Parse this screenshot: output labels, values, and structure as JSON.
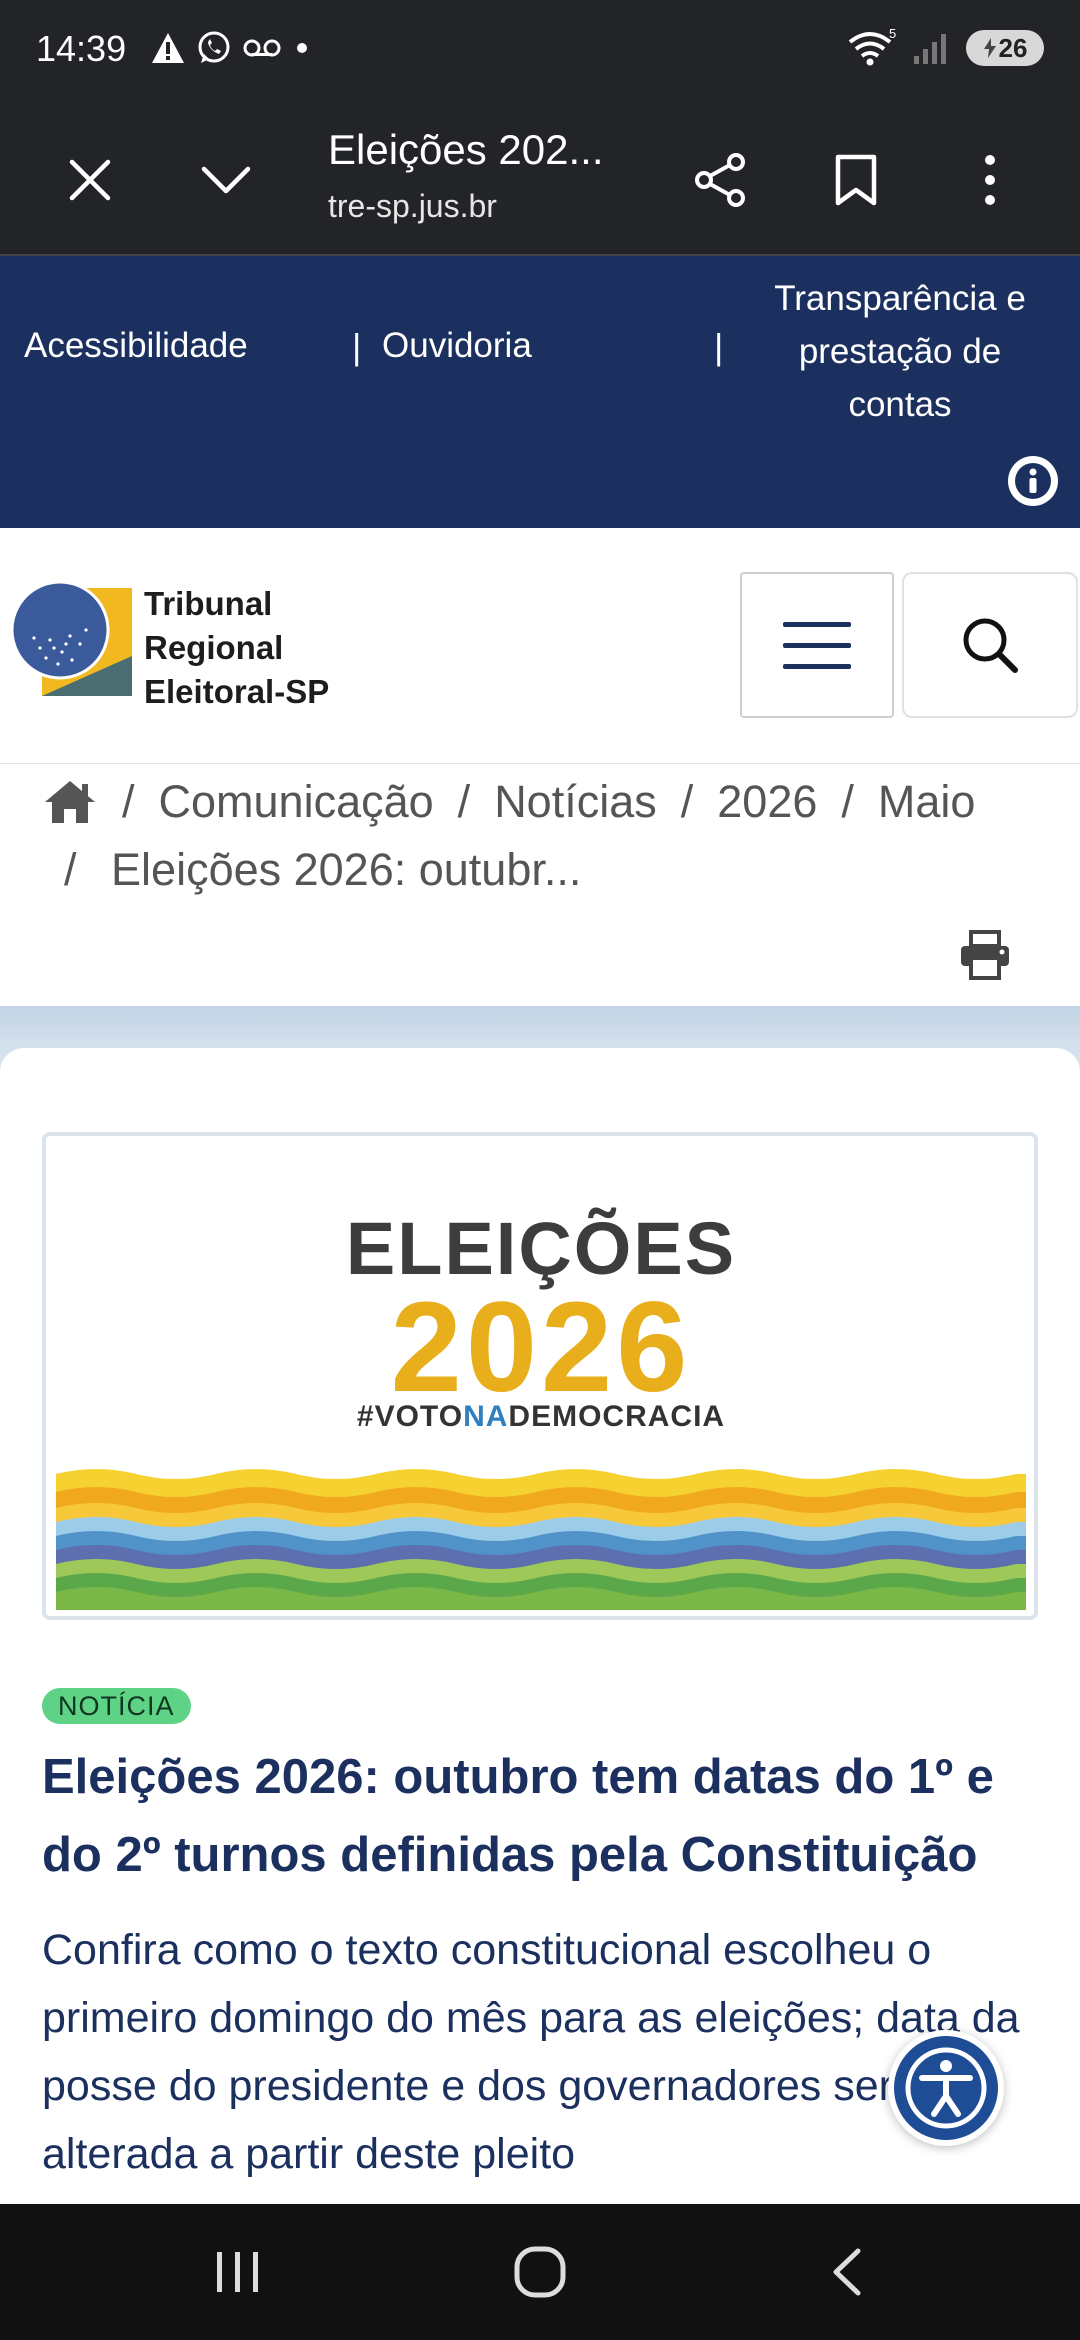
{
  "status_bar": {
    "time": "14:39",
    "left_icons": [
      "warning-icon",
      "whatsapp-icon",
      "voicemail-icon",
      "dot-icon"
    ],
    "wifi_badge": "5",
    "battery_level": "26"
  },
  "browser": {
    "page_title": "Eleições 202...",
    "url": "tre-sp.jus.br",
    "icons": [
      "close-icon",
      "chevron-down-icon",
      "share-icon",
      "bookmark-icon",
      "more-vertical-icon"
    ]
  },
  "top_nav": {
    "accessibility": "Acessibilidade",
    "ombudsman": "Ouvidoria",
    "transparency_line1": "Transparência e",
    "transparency_line2": "prestação de",
    "transparency_line3": "contas",
    "separator": "|",
    "info_icon": "info-icon"
  },
  "header": {
    "logo_line1": "Tribunal",
    "logo_line2": "Regional",
    "logo_line3": "Eleitoral-SP",
    "menu_icon": "hamburger-icon",
    "search_icon": "search-icon"
  },
  "breadcrumb": {
    "separator": "/",
    "items": [
      "Comunicação",
      "Notícias",
      "2026",
      "Maio"
    ],
    "current": "Eleições 2026: outubr...",
    "print_icon": "print-icon"
  },
  "article": {
    "hero": {
      "title": "ELEIÇÕES",
      "year": "2026",
      "tag_part1": "#VOTO",
      "tag_part2": "NA",
      "tag_part3": "DEMOCRACIA"
    },
    "badge": "NOTÍCIA",
    "headline": "Eleições 2026: outubro tem datas do 1º e do 2º turnos definidas pela Constituição",
    "summary": "Confira como o texto constitucional escolheu o primeiro domingo do mês para as eleições; data da posse do presidente e dos governadores será alterada a partir deste pleito"
  },
  "colors": {
    "nav_blue": "#1c3060",
    "accent_yellow": "#e8ae1b",
    "badge_green": "#5ed285",
    "fab_blue": "#1e4c95"
  },
  "android_nav": [
    "recent-apps-icon",
    "home-icon",
    "back-icon"
  ]
}
